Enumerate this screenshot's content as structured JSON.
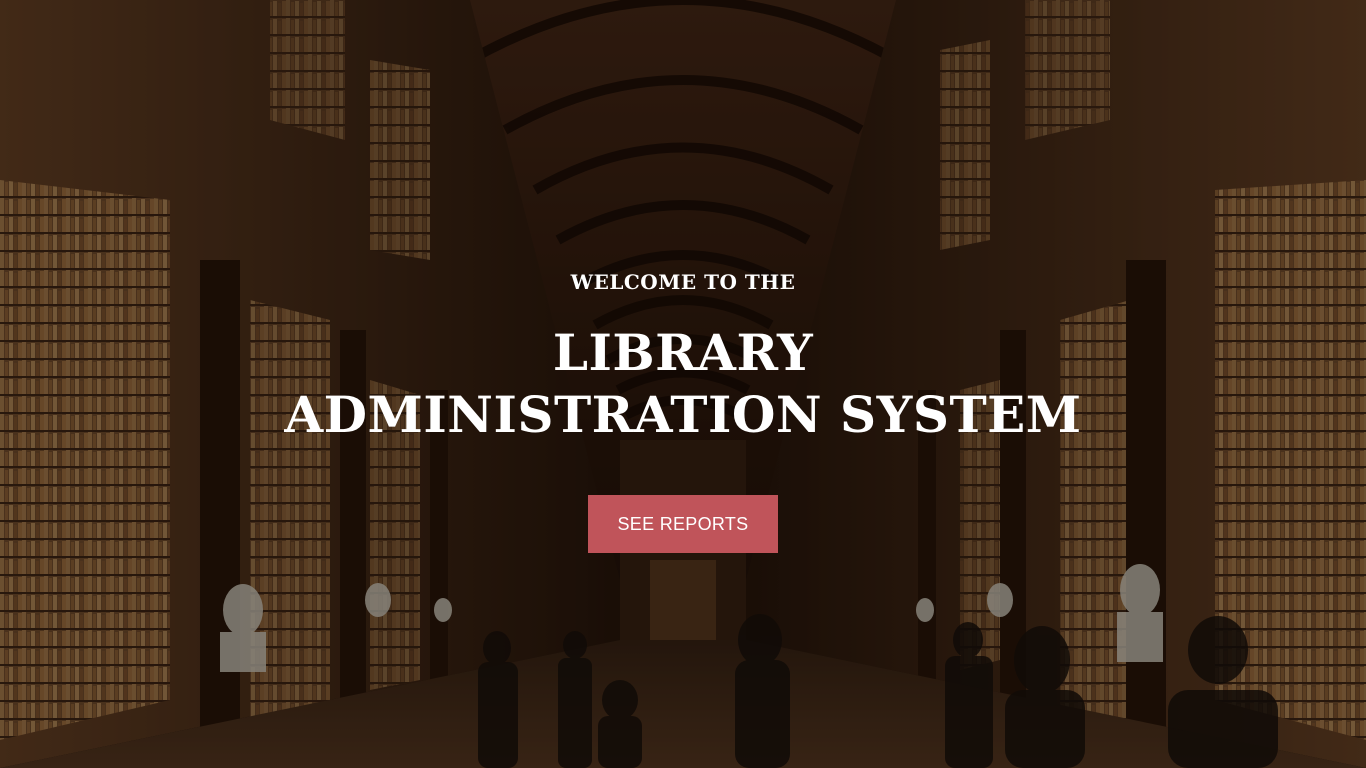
{
  "hero": {
    "eyebrow": "WELCOME TO THE",
    "title": "LIBRARY ADMINISTRATION SYSTEM",
    "cta_label": "SEE REPORTS",
    "cta_color": "#c0545a",
    "background_image": "library-hall-photo"
  }
}
